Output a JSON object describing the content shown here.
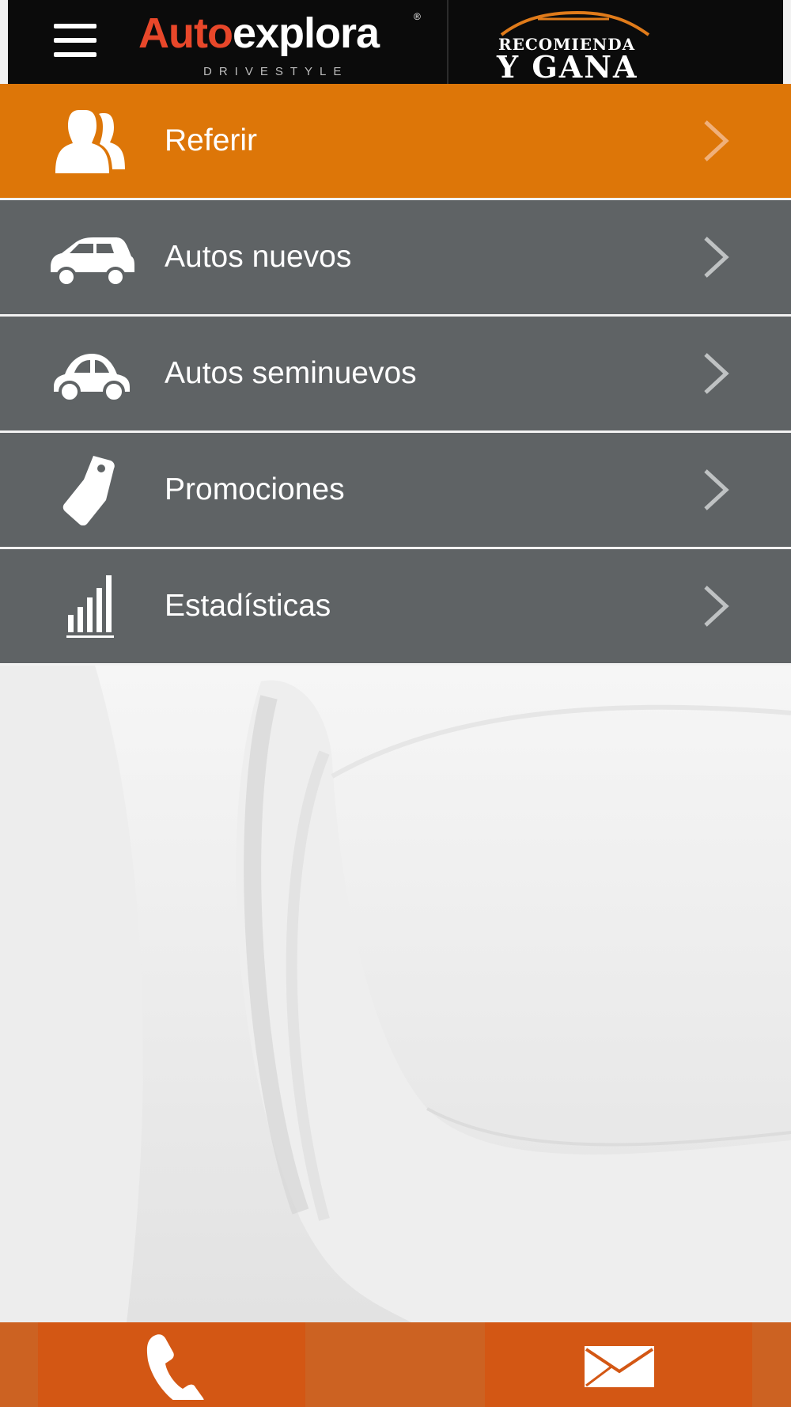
{
  "header": {
    "menu_icon": "hamburger-icon",
    "brand": {
      "part1": "Auto",
      "part2": "explora",
      "registered": "®",
      "tagline": "DRIVESTYLE"
    },
    "promo": {
      "line1": "RECOMIENDA",
      "line2": "Y GANA"
    }
  },
  "menu": {
    "items": [
      {
        "label": "Referir",
        "icon": "referral-users-icon",
        "active": true
      },
      {
        "label": "Autos nuevos",
        "icon": "new-car-icon",
        "active": false
      },
      {
        "label": "Autos seminuevos",
        "icon": "used-car-icon",
        "active": false
      },
      {
        "label": "Promociones",
        "icon": "price-tag-icon",
        "active": false
      },
      {
        "label": "Estadísticas",
        "icon": "bar-chart-icon",
        "active": false
      }
    ]
  },
  "footer": {
    "phone_icon": "phone-icon",
    "mail_icon": "mail-icon"
  },
  "colors": {
    "accent": "#dd7608",
    "menu_bg": "#5f6365",
    "header_bg": "#0b0b0b",
    "brand_red": "#e8472a",
    "footer_btn": "#d35714"
  }
}
